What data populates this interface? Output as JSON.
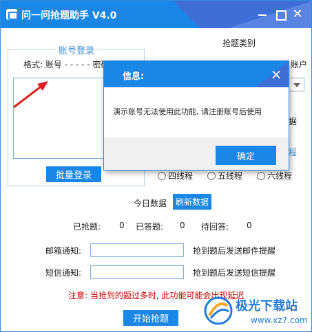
{
  "window": {
    "title": "问一问抢题助手 V4.0"
  },
  "account_group": {
    "title": "账号登录",
    "format_label": "格式: 账号 - - - - - 密码",
    "batch_login_label": "批量登录"
  },
  "options": {
    "category_label": "抢题类别",
    "account_peek": "账户",
    "data_peek": "据",
    "thread_peek": "程",
    "threads": [
      "四线程",
      "五线程",
      "六线程"
    ]
  },
  "today": {
    "label": "今日数据",
    "refresh_label": "刷新数据"
  },
  "stats": {
    "grabbed_label": "已抢题:",
    "grabbed_value": "0",
    "answered_label": "已答题:",
    "answered_value": "0",
    "pending_label": "待回答:",
    "pending_value": "0"
  },
  "notify": {
    "email_label": "邮箱通知:",
    "email_value": "",
    "email_hint": "抢到题后发送邮件提醒",
    "sms_label": "短信通知:",
    "sms_value": "",
    "sms_hint": "抢到题后发送短信提醒"
  },
  "warning": "注意: 当抢到的题过多时, 此功能可能会出现延迟",
  "start_label": "开始抢题",
  "watermark": {
    "text": "极光下载站",
    "url": "www.xz7.com"
  },
  "dialog": {
    "title": "信息:",
    "message": "演示账号无法使用此功能, 请注册账号后使用",
    "ok_label": "确定"
  },
  "colors": {
    "accent": "#1a86e5",
    "warning": "#c80000"
  }
}
